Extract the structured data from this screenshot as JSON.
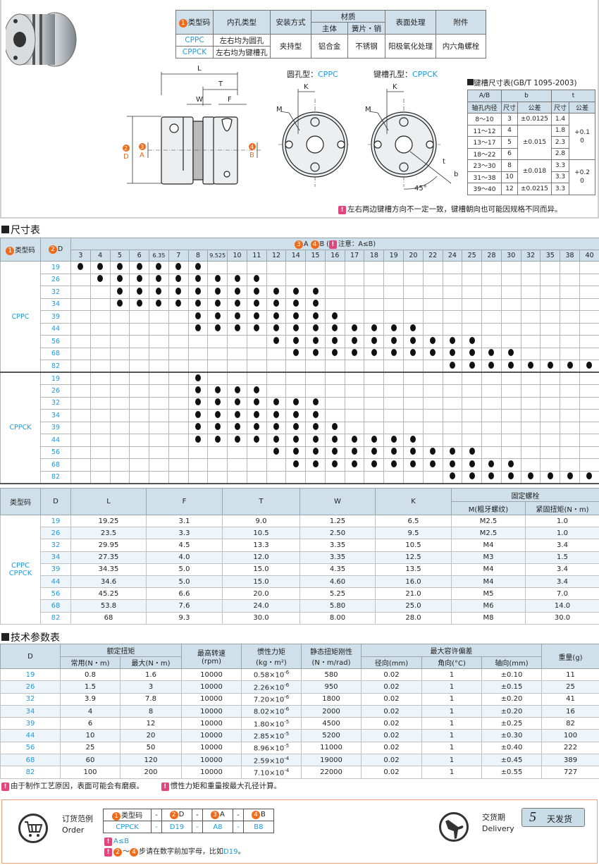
{
  "spec_table": {
    "headers": {
      "type_code": "类型码",
      "type_num": "1",
      "bore_type": "内孔类型",
      "mount": "安装方式",
      "material": "材质",
      "body": "主体",
      "spring_pin": "簧片・销",
      "surface": "表面处理",
      "accessory": "附件"
    },
    "rows": [
      {
        "code": "CPPC",
        "bore": "左右均为圆孔"
      },
      {
        "code": "CPPCK",
        "bore": "左右均为键槽孔"
      }
    ],
    "mount": "夹持型",
    "body": "铝合金",
    "spring_pin": "不锈钢",
    "surface": "阳极氧化处理",
    "accessory": "内六角螺栓"
  },
  "drawing": {
    "round_title": "圆孔型：",
    "round_code": "CPPC",
    "key_title": "键槽孔型：",
    "key_code": "CPPCK",
    "labels": {
      "L": "L",
      "T": "T",
      "W": "W",
      "F": "F",
      "D": "D",
      "A": "A",
      "B": "B",
      "K": "K",
      "M": "M",
      "angle": "45°",
      "t": "t",
      "b": "b",
      "n2": "2",
      "n3": "3",
      "n4": "4"
    },
    "note": "左右两边键槽方向不一定一致，键槽朝向也可能因规格不同而异。"
  },
  "key_table": {
    "title": "键槽尺寸表(GB/T 1095-2003)",
    "h_ab": "A/B",
    "h_bore": "轴孔内径",
    "h_b": "b",
    "h_t": "t",
    "h_size": "尺寸",
    "h_tol": "公差",
    "rows": [
      {
        "range": "8～10",
        "b": "3",
        "t": "1.4"
      },
      {
        "range": "11～12",
        "b": "4",
        "t": "1.8"
      },
      {
        "range": "13～17",
        "b": "5",
        "t": "2.3"
      },
      {
        "range": "18～22",
        "b": "6",
        "t": "2.8"
      },
      {
        "range": "23～30",
        "b": "8",
        "t": "3.3"
      },
      {
        "range": "31～38",
        "b": "10",
        "t": "3.3"
      },
      {
        "range": "39～40",
        "b": "12",
        "t": "3.3"
      }
    ],
    "b_tol": [
      "±0.0125",
      "±0.015",
      "±0.018",
      "±0.0215"
    ],
    "t_tol": [
      "+0.1\n0",
      "+0.2\n0"
    ]
  },
  "size_section": {
    "title": "尺寸表",
    "h_type": "类型码",
    "h_d": "D",
    "h_ab_a": "A",
    "h_ab_b": "B",
    "h_note": "(",
    "h_note2": "注意：A≤B)",
    "bores": [
      "3",
      "4",
      "5",
      "6",
      "6.35",
      "7",
      "8",
      "9.525",
      "10",
      "11",
      "12",
      "14",
      "15",
      "16",
      "17",
      "18",
      "19",
      "20",
      "22",
      "24",
      "25",
      "28",
      "30",
      "32",
      "35",
      "38",
      "40"
    ],
    "groups": [
      {
        "code": "CPPC",
        "rows": [
          {
            "d": "19",
            "from": 0,
            "to": 6
          },
          {
            "d": "26",
            "from": 1,
            "to": 9
          },
          {
            "d": "32",
            "from": 2,
            "to": 12
          },
          {
            "d": "34",
            "from": 2,
            "to": 12
          },
          {
            "d": "39",
            "from": 6,
            "to": 13
          },
          {
            "d": "44",
            "from": 6,
            "to": 17
          },
          {
            "d": "56",
            "from": 10,
            "to": 20
          },
          {
            "d": "68",
            "from": 11,
            "to": 22
          },
          {
            "d": "82",
            "from": 19,
            "to": 26
          }
        ]
      },
      {
        "code": "CPPCK",
        "rows": [
          {
            "d": "19",
            "from": 6,
            "to": 6
          },
          {
            "d": "26",
            "from": 6,
            "to": 9
          },
          {
            "d": "32",
            "from": 6,
            "to": 12
          },
          {
            "d": "34",
            "from": 6,
            "to": 12
          },
          {
            "d": "39",
            "from": 6,
            "to": 13
          },
          {
            "d": "44",
            "from": 6,
            "to": 17
          },
          {
            "d": "56",
            "from": 10,
            "to": 20
          },
          {
            "d": "68",
            "from": 11,
            "to": 22
          },
          {
            "d": "82",
            "from": 19,
            "to": 26
          }
        ]
      }
    ]
  },
  "dim_table": {
    "headers": {
      "type": "类型码",
      "d": "D",
      "l": "L",
      "f": "F",
      "t": "T",
      "w": "W",
      "k": "K",
      "bolt": "固定螺栓",
      "m": "M(粗牙螺纹)",
      "torque": "紧固扭矩(N・m)"
    },
    "type_codes": "CPPC\nCPPCK",
    "rows": [
      [
        "19",
        "19.25",
        "3.1",
        "9.0",
        "1.25",
        "6.5",
        "M2.5",
        "1.0"
      ],
      [
        "26",
        "23.5",
        "3.3",
        "10.5",
        "2.50",
        "9.5",
        "M2.5",
        "1.0"
      ],
      [
        "32",
        "29.95",
        "4.5",
        "13.3",
        "3.35",
        "10.5",
        "M4",
        "3.4"
      ],
      [
        "34",
        "27.35",
        "4.0",
        "12.0",
        "3.35",
        "12.5",
        "M3",
        "1.5"
      ],
      [
        "39",
        "34.35",
        "5.0",
        "15.0",
        "4.35",
        "13.5",
        "M4",
        "3.4"
      ],
      [
        "44",
        "34.6",
        "5.0",
        "15.0",
        "4.60",
        "16.0",
        "M4",
        "3.4"
      ],
      [
        "56",
        "45.25",
        "6.6",
        "20.0",
        "5.25",
        "21.0",
        "M5",
        "7.0"
      ],
      [
        "68",
        "53.8",
        "7.6",
        "24.0",
        "5.80",
        "25.0",
        "M6",
        "14.0"
      ],
      [
        "82",
        "68",
        "9.3",
        "30.0",
        "8.00",
        "28.0",
        "M8",
        "30.0"
      ]
    ]
  },
  "tech_section": {
    "title": "技术参数表",
    "headers": {
      "d": "D",
      "rated": "额定扭矩",
      "normal": "常用(N・m)",
      "max": "最大(N・m)",
      "speed": "最高转速",
      "speed_u": "(rpm)",
      "inertia": "惯性力矩",
      "inertia_u": "(kg・m²)",
      "stiff": "静态扭矩刚性",
      "stiff_u": "(N・m/rad)",
      "misalign": "最大容许偏差",
      "radial": "径向(mm)",
      "angular": "角向(°C)",
      "axial": "轴向(mm)",
      "weight": "重量(g)"
    },
    "rows": [
      {
        "d": "19",
        "n": "0.8",
        "m": "1.6",
        "s": "10000",
        "im": "0.58×10",
        "ie": "-6",
        "st": "580",
        "r": "0.02",
        "a": "1",
        "ax": "±0.10",
        "w": "11"
      },
      {
        "d": "26",
        "n": "1.5",
        "m": "3",
        "s": "10000",
        "im": "2.26×10",
        "ie": "-6",
        "st": "950",
        "r": "0.02",
        "a": "1",
        "ax": "±0.15",
        "w": "25"
      },
      {
        "d": "32",
        "n": "3.9",
        "m": "7.8",
        "s": "10000",
        "im": "7.20×10",
        "ie": "-6",
        "st": "1800",
        "r": "0.02",
        "a": "1",
        "ax": "±0.20",
        "w": "41"
      },
      {
        "d": "34",
        "n": "4",
        "m": "8",
        "s": "10000",
        "im": "8.02×10",
        "ie": "-6",
        "st": "2000",
        "r": "0.02",
        "a": "1",
        "ax": "±0.20",
        "w": "16"
      },
      {
        "d": "39",
        "n": "6",
        "m": "12",
        "s": "10000",
        "im": "1.80×10",
        "ie": "-5",
        "st": "4500",
        "r": "0.02",
        "a": "1",
        "ax": "±0.25",
        "w": "82"
      },
      {
        "d": "44",
        "n": "10",
        "m": "20",
        "s": "10000",
        "im": "2.85×10",
        "ie": "-5",
        "st": "5200",
        "r": "0.02",
        "a": "1",
        "ax": "±0.30",
        "w": "100"
      },
      {
        "d": "56",
        "n": "25",
        "m": "50",
        "s": "10000",
        "im": "8.96×10",
        "ie": "-5",
        "st": "11000",
        "r": "0.02",
        "a": "1",
        "ax": "±0.40",
        "w": "222"
      },
      {
        "d": "68",
        "n": "60",
        "m": "120",
        "s": "10000",
        "im": "2.59×10",
        "ie": "-4",
        "st": "19000",
        "r": "0.02",
        "a": "1",
        "ax": "±0.45",
        "w": "389"
      },
      {
        "d": "82",
        "n": "100",
        "m": "200",
        "s": "10000",
        "im": "7.10×10",
        "ie": "-4",
        "st": "22000",
        "r": "0.02",
        "a": "1",
        "ax": "±0.55",
        "w": "727"
      }
    ],
    "notes": [
      "由于制作工艺原因，表面可能会有磨痕。",
      "惯性力矩和重量按最大孔径计算。"
    ]
  },
  "order": {
    "title": "订货范例",
    "title_en": "Order",
    "headers": [
      "类型码",
      "D",
      "A",
      "B"
    ],
    "nums": [
      "1",
      "2",
      "3",
      "4"
    ],
    "values": [
      "CPPCK",
      "D19",
      "A8",
      "B8"
    ],
    "sep": "-",
    "note1": "A≤B",
    "note2_mid": "～",
    "note2_text": "步请在数字前加字母，比如",
    "note2_example": "D19",
    "note2_end": "。",
    "warn": "!"
  },
  "delivery": {
    "title": "交货期",
    "title_en": "Delivery",
    "days": "5",
    "days_label": "天发货"
  },
  "colors": {
    "accent_blue": "#1a9be0",
    "orange": "#f06a1a",
    "pink": "#e0457b",
    "header_bg": "#cfe0ea"
  }
}
